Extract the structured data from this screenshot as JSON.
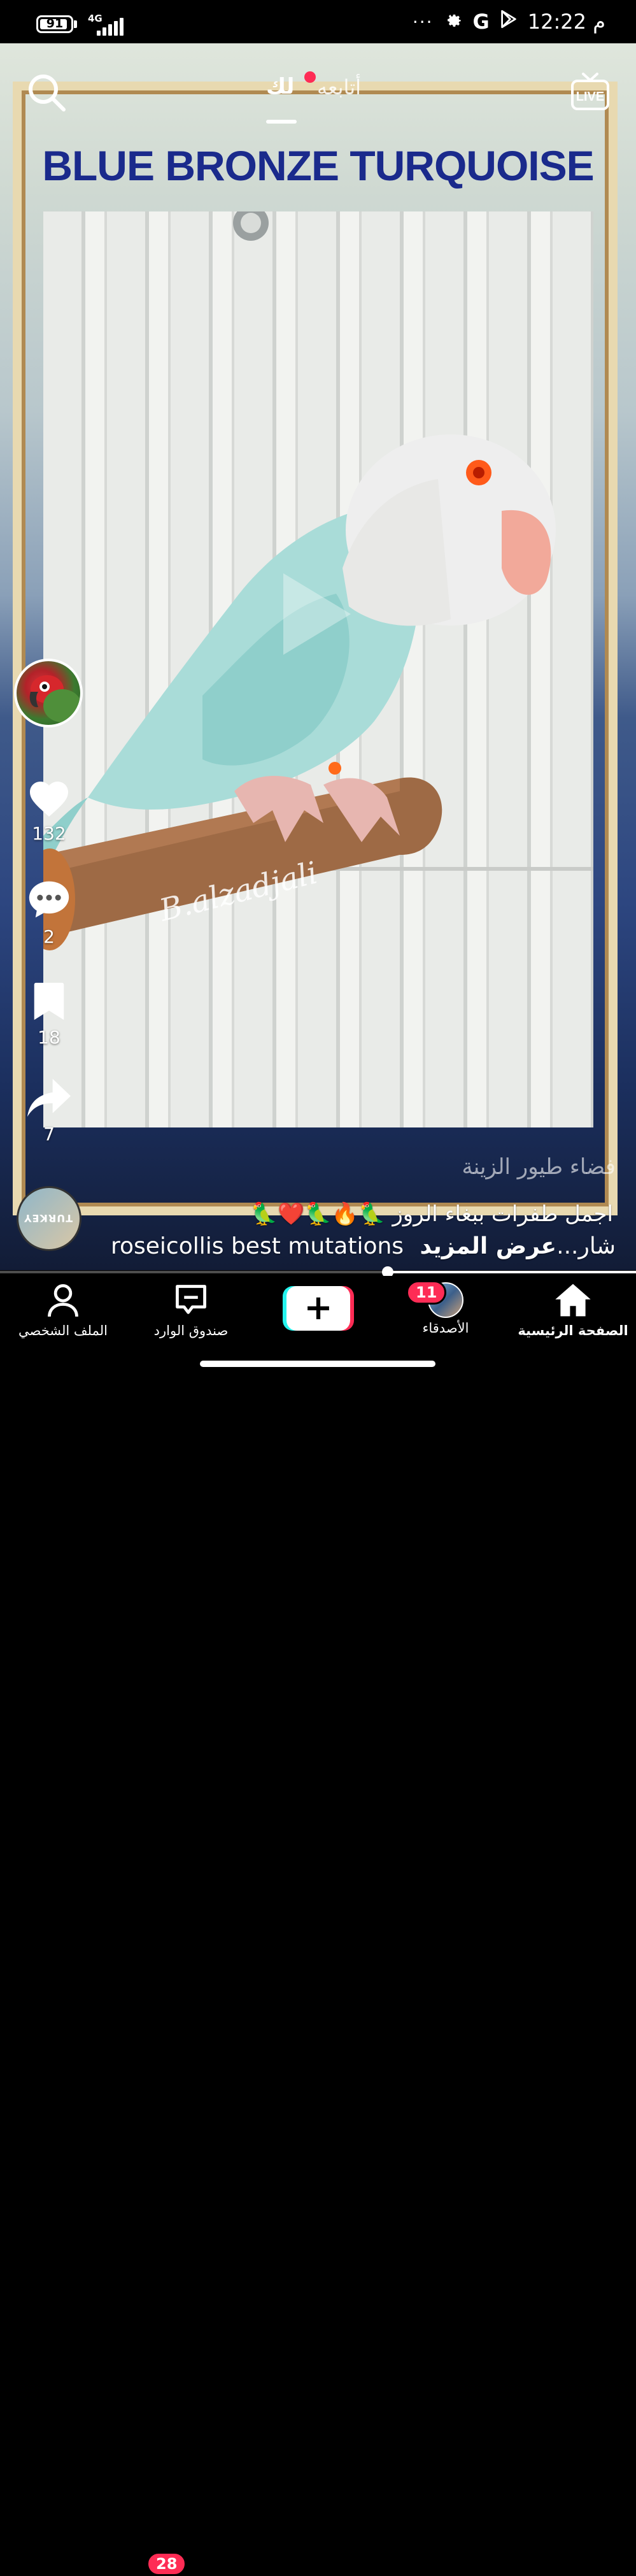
{
  "status_bar": {
    "battery": "91",
    "battery_level_percent": 91,
    "network": "4G",
    "time": "12:22 م",
    "overflow": "···",
    "icons": [
      "settings-icon",
      "google-icon",
      "play-store-icon"
    ]
  },
  "top_nav": {
    "tab_following": "أتابعه",
    "tab_for_you": "لك",
    "live_label": "LIVE",
    "icons": [
      "search-icon",
      "live-tv-icon"
    ]
  },
  "video": {
    "title": "BLUE BRONZE TURQUOISE",
    "watermark": "B.alzadjali",
    "author": "فضاء طيور الزينة",
    "caption_line1": "اجمل طفرات ببغاء الروز 🦜🔥🦜❤️🦜",
    "caption_line2": "roseicollis best mutations شار...",
    "see_more": "عرض المزيد",
    "progress_fraction": 0.61,
    "music_disc_label": "TURKEY"
  },
  "actions": {
    "likes": "132",
    "comments": "2",
    "saves": "18",
    "shares": "7"
  },
  "bottom_nav": {
    "home": "الصفحة الرئيسية",
    "friends": "الأصدقاء",
    "friends_badge": "11",
    "inbox": "صندوق الوارد",
    "inbox_badge": "28",
    "profile": "الملف الشخصي",
    "add_symbol": "+"
  },
  "colors": {
    "accent_red": "#fe2c55",
    "accent_cyan": "#25f4ee",
    "title_blue": "#1a2a8c"
  }
}
